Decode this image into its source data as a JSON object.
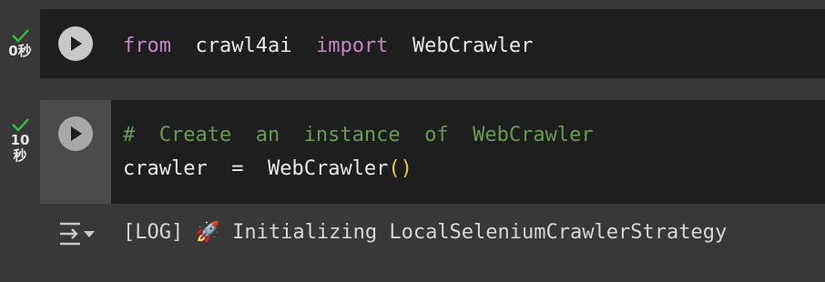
{
  "cells": [
    {
      "status": {
        "time_label": "0秒"
      },
      "code": {
        "kw1": "from",
        "module": "crawl4ai",
        "kw2": "import",
        "name": "WebCrawler"
      }
    },
    {
      "status": {
        "time_line1": "10",
        "time_line2": "秒"
      },
      "code": {
        "comment": "#  Create  an  instance  of  WebCrawler",
        "var": "crawler",
        "op": "=",
        "call": "WebCrawler",
        "parens": "()"
      },
      "output": {
        "prefix": "[LOG]",
        "icon": "rocket-icon",
        "message": "Initializing LocalSeleniumCrawlerStrategy"
      }
    }
  ],
  "colors": {
    "keyword": "#c586c0",
    "comment": "#6a9955",
    "paren": "#e8c55a",
    "check": "#3fba4e"
  }
}
